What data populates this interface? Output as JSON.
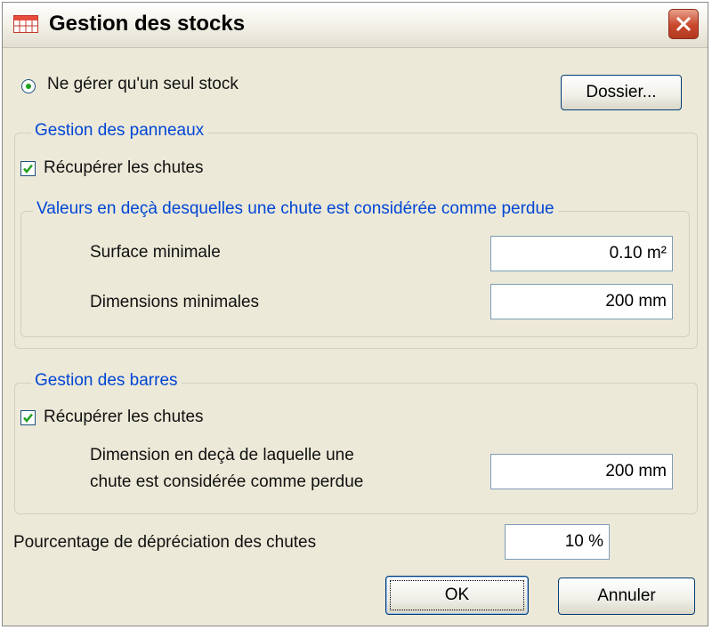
{
  "window": {
    "title": "Gestion des stocks"
  },
  "top": {
    "radio_label": "Ne gérer qu'un seul stock",
    "folder_button": "Dossier..."
  },
  "panels": {
    "legend": "Gestion des panneaux",
    "recover_label": "Récupérer les chutes",
    "recover_checked": true,
    "thresholds_legend": "Valeurs en deçà desquelles une chute est considérée comme perdue",
    "min_surface_label": "Surface minimale",
    "min_surface_value": "0.10 m²",
    "min_dimensions_label": "Dimensions minimales",
    "min_dimensions_value": "200 mm"
  },
  "bars": {
    "legend": "Gestion des barres",
    "recover_label": "Récupérer les chutes",
    "recover_checked": true,
    "dimension_label_line1": "Dimension en deçà de laquelle une",
    "dimension_label_line2": "chute est considérée comme perdue",
    "dimension_value": "200 mm"
  },
  "depreciation": {
    "label": "Pourcentage de dépréciation des chutes",
    "value": "10 %"
  },
  "buttons": {
    "ok": "OK",
    "cancel": "Annuler"
  },
  "colors": {
    "dialog_bg": "#ece9d8",
    "legend_blue": "#0046d5",
    "check_green": "#21a121",
    "close_red": "#c9472b"
  }
}
